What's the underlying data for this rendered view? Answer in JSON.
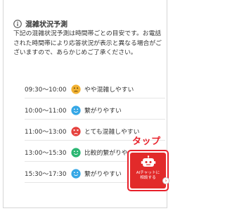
{
  "section": {
    "title": "混雑状況予測",
    "description": "下記の混雑状況予測は時間帯ごとの目安です。お電話された時間帯により応答状況が表示と異なる場合がございますので、あらかじめご了承ください。"
  },
  "forecast": [
    {
      "time": "09:30〜10:00",
      "status": "やや混雑しやすい",
      "level": "moderate",
      "color": "#f2b233",
      "icon": "worried-face-icon"
    },
    {
      "time": "10:00〜11:00",
      "status": "繋がりやすい",
      "level": "easy",
      "color": "#35a7e6",
      "icon": "smile-face-icon"
    },
    {
      "time": "11:00〜13:00",
      "status": "とても混雑しやすい",
      "level": "very-busy",
      "color": "#e5403c",
      "icon": "dizzy-face-icon"
    },
    {
      "time": "13:00〜15:30",
      "status": "比較的繋がりやすい",
      "level": "fairly-easy",
      "color": "#2bb673",
      "icon": "smile-face-icon"
    },
    {
      "time": "15:30〜17:30",
      "status": "繋がりやすい",
      "level": "easy",
      "color": "#35a7e6",
      "icon": "smile-face-icon"
    }
  ],
  "annotation": {
    "tap_label": "タップ",
    "color": "#e8202a"
  },
  "chat_button": {
    "label": "AIチャットに\n相談する",
    "color": "#e22a2a",
    "icon": "robot-icon",
    "arrow_icon": "chevron-right-icon"
  }
}
